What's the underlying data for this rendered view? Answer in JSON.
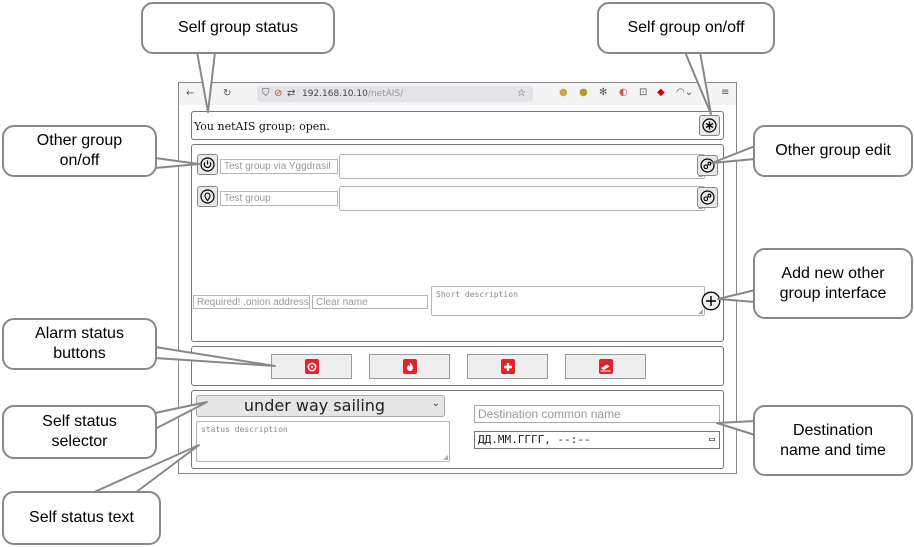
{
  "browser": {
    "url_host": "192.168.10.10",
    "url_path": "/netAIS/"
  },
  "self_group": {
    "status_text": "You netAIS group: open."
  },
  "other_groups": [
    {
      "name_placeholder": "Test group via Yggdrasil"
    },
    {
      "name_placeholder": "Test group"
    }
  ],
  "new_group": {
    "address_placeholder": "Required! .onion address",
    "name_placeholder": "Clear name",
    "description_placeholder": "Short description"
  },
  "alarm_buttons": [
    {
      "icon": "mob-icon"
    },
    {
      "icon": "fire-icon"
    },
    {
      "icon": "medical-icon"
    },
    {
      "icon": "sinking-icon"
    }
  ],
  "self_status": {
    "selected": "under way sailing",
    "description_placeholder": "status description"
  },
  "destination": {
    "name_placeholder": "Destination common name",
    "datetime_placeholder": "ДД.ММ.ГГГГ, --:--"
  },
  "callouts": {
    "self_group_status": "Self group status",
    "self_group_onoff": "Self group on/off",
    "other_group_onoff": "Other group on/off",
    "other_group_edit": "Other group edit",
    "add_new_group": "Add new other group interface",
    "alarm_status": "Alarm status buttons",
    "self_status_selector": "Self status selector",
    "destination": "Destination name and time",
    "self_status_text": "Self status text"
  },
  "colors": {
    "alarm_red": "#e8202a",
    "callout_border": "#888888"
  }
}
